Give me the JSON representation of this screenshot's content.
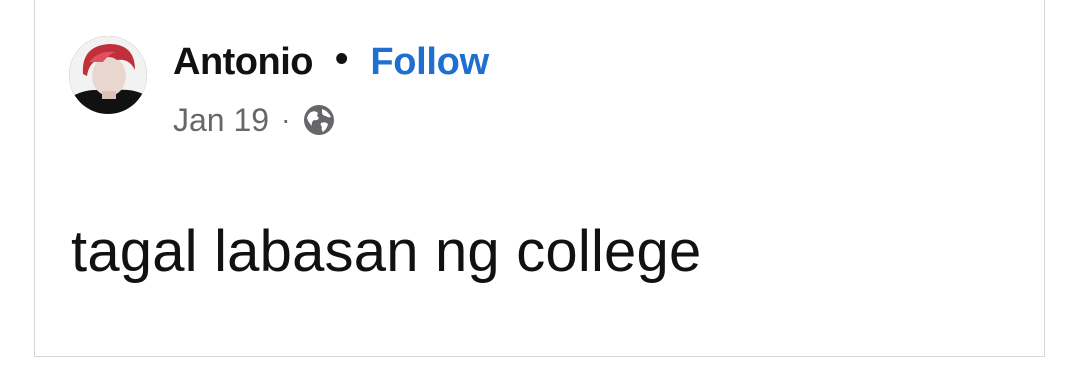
{
  "post": {
    "author": {
      "name": "Antonio",
      "avatar_icon": "profile-photo"
    },
    "separator": "•",
    "follow_label": "Follow",
    "date": "Jan 19",
    "meta_separator": "·",
    "audience_icon": "globe-icon",
    "text": "tagal labasan ng college"
  },
  "colors": {
    "follow": "#1f6fd1",
    "meta": "#65676b",
    "text": "#111111",
    "border": "#d7d7d7"
  }
}
